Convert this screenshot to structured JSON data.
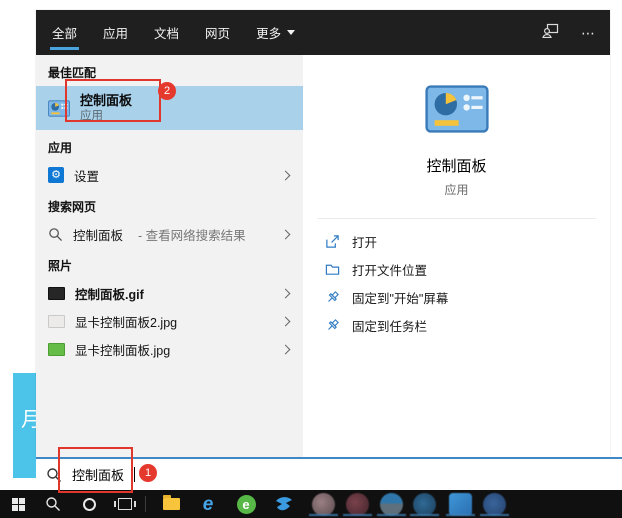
{
  "colors": {
    "accent_blue": "#4ba3dd",
    "highlight_blue": "#a9d1ea",
    "annotation_red": "#e0372c",
    "header_dark": "#1f1f1f",
    "taskbar_black": "#101010"
  },
  "icons": {
    "gear": "⚙",
    "ellipsis": "⋯",
    "ie_letter": "e",
    "green_browser_letter": "e"
  },
  "desktop": {
    "fragment_text": "月"
  },
  "panel": {
    "tabs": [
      {
        "label": "全部"
      },
      {
        "label": "应用"
      },
      {
        "label": "文档"
      },
      {
        "label": "网页"
      },
      {
        "label": "更多"
      }
    ],
    "sections": {
      "best_match": {
        "header": "最佳匹配",
        "item": {
          "title": "控制面板",
          "subtitle": "应用"
        }
      },
      "apps": {
        "header": "应用",
        "items": [
          {
            "label": "设置"
          }
        ]
      },
      "web": {
        "header": "搜索网页",
        "items": [
          {
            "label": "控制面板",
            "suffix": "- 查看网络搜索结果"
          }
        ]
      },
      "photos": {
        "header": "照片",
        "items": [
          {
            "label": "控制面板.gif"
          },
          {
            "label": "显卡控制面板2.jpg"
          },
          {
            "label": "显卡控制面板.jpg"
          }
        ]
      }
    },
    "detail": {
      "title": "控制面板",
      "subtitle": "应用",
      "actions": [
        {
          "label": "打开"
        },
        {
          "label": "打开文件位置"
        },
        {
          "label": "固定到\"开始\"屏幕"
        },
        {
          "label": "固定到任务栏"
        }
      ]
    }
  },
  "search_box": {
    "value": "控制面板"
  },
  "annotations": {
    "step1": "1",
    "step2": "2"
  }
}
